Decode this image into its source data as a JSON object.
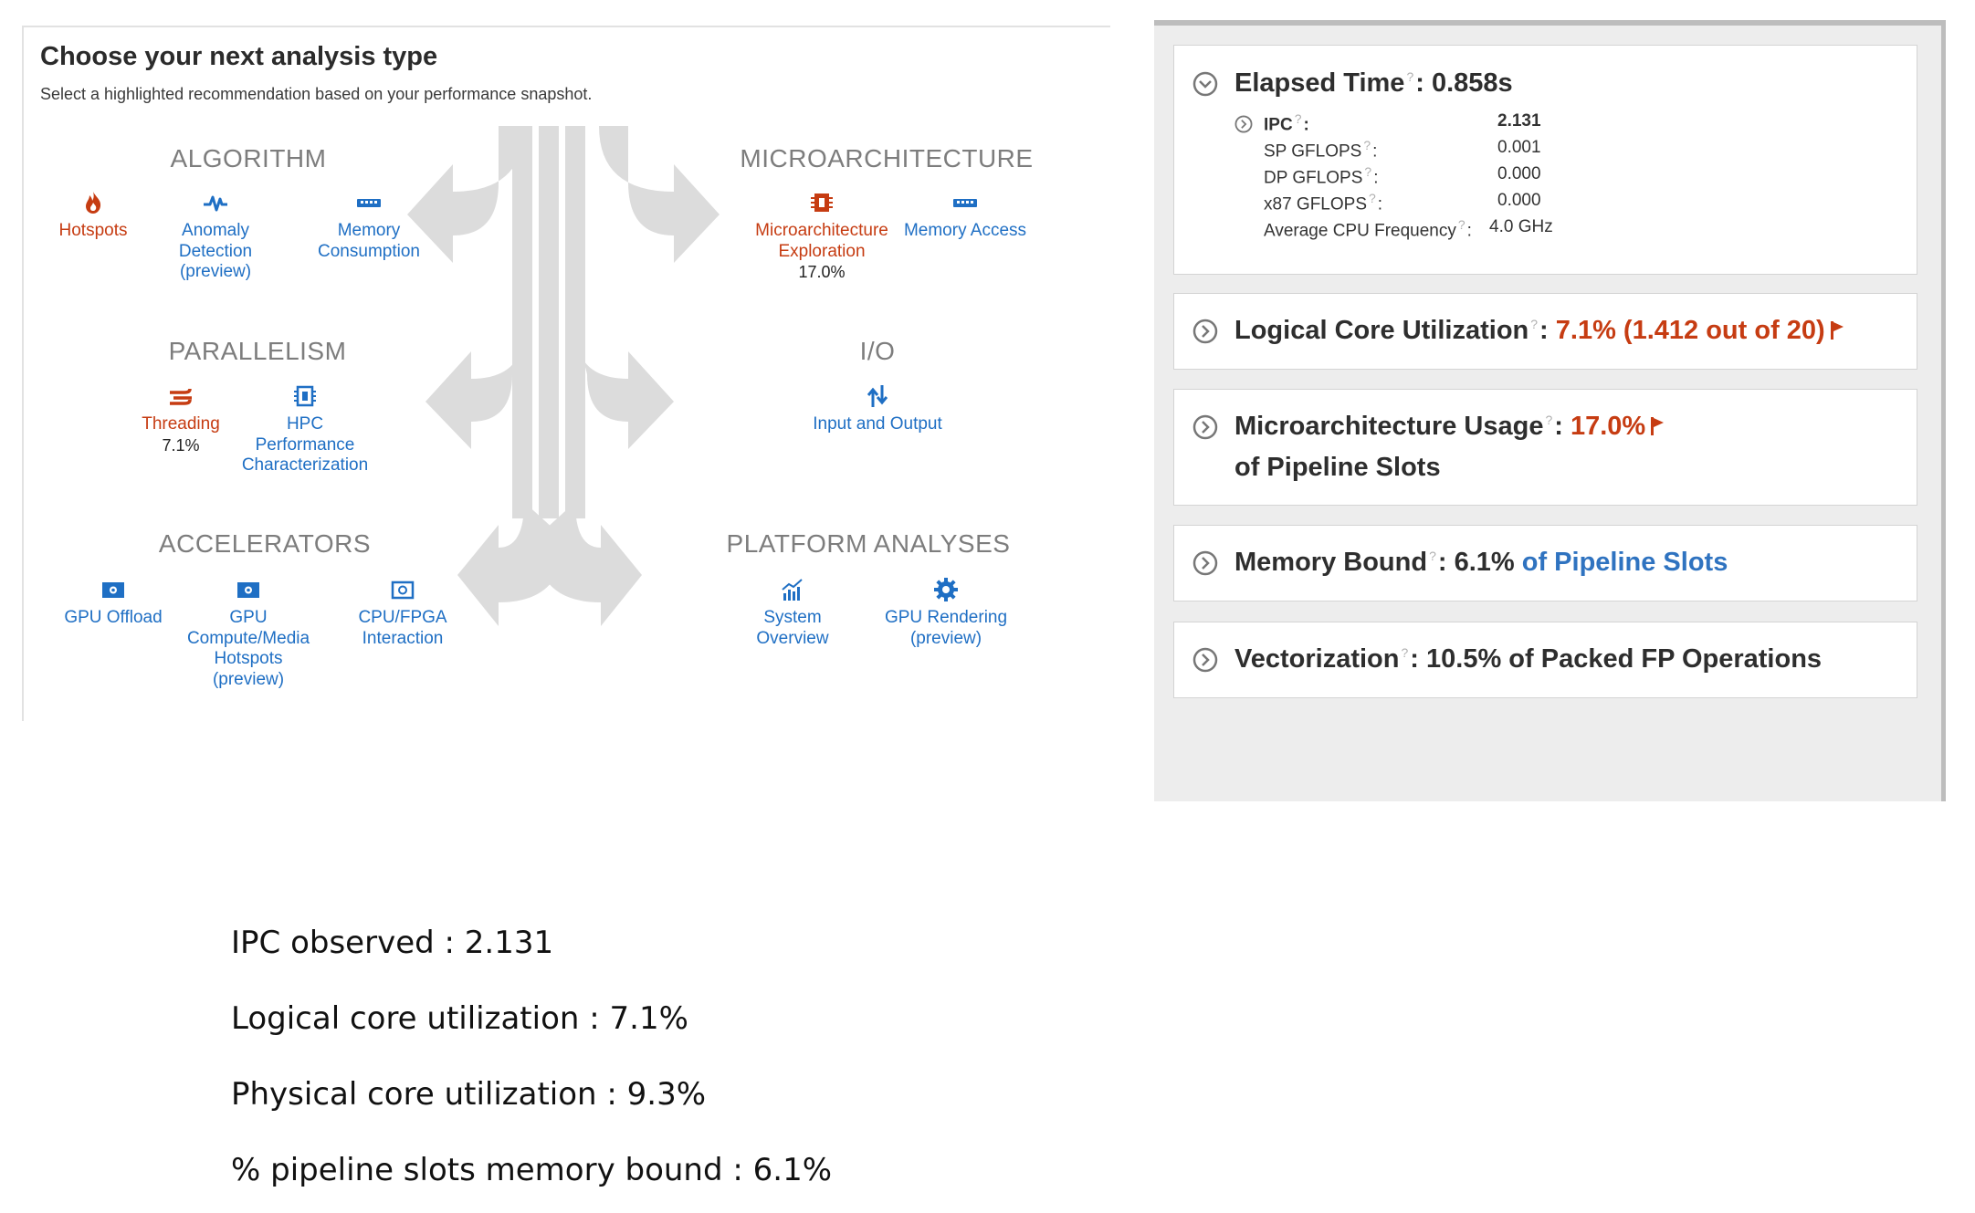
{
  "analysis": {
    "title": "Choose your next analysis type",
    "subtitle": "Select a highlighted recommendation based on your performance snapshot.",
    "categories": {
      "algorithm": "ALGORITHM",
      "parallelism": "PARALLELISM",
      "accelerators": "ACCELERATORS",
      "microarchitecture": "MICROARCHITECTURE",
      "io": "I/O",
      "platform": "PLATFORM ANALYSES"
    },
    "items": {
      "hotspots": {
        "label": "Hotspots",
        "icon": "flame-icon"
      },
      "anomaly": {
        "label": "Anomaly\nDetection\n(preview)",
        "icon": "pulse-icon"
      },
      "memory_consumption": {
        "label": "Memory\nConsumption",
        "icon": "memory-chip-icon"
      },
      "threading": {
        "label": "Threading",
        "value": "7.1%",
        "icon": "threads-icon"
      },
      "hpc": {
        "label": "HPC\nPerformance\nCharacterization",
        "icon": "cpu-icon"
      },
      "gpu_offload": {
        "label": "GPU Offload",
        "icon": "gpu-card-icon"
      },
      "gpu_compute": {
        "label": "GPU\nCompute/Media\nHotspots\n(preview)",
        "icon": "gpu-card-icon"
      },
      "cpu_fpga": {
        "label": "CPU/FPGA\nInteraction",
        "icon": "fpga-card-icon"
      },
      "microarch_exploration": {
        "label": "Microarchitecture\nExploration",
        "value": "17.0%",
        "icon": "cpu-icon"
      },
      "memory_access": {
        "label": "Memory Access",
        "icon": "memory-chip-icon"
      },
      "input_output": {
        "label": "Input and Output",
        "icon": "up-down-arrows-icon"
      },
      "system_overview": {
        "label": "System\nOverview",
        "icon": "bar-chart-icon"
      },
      "gpu_rendering": {
        "label": "GPU Rendering\n(preview)",
        "icon": "gear-icon"
      }
    }
  },
  "summary": {
    "elapsed": {
      "label": "Elapsed Time",
      "value": "0.858s"
    },
    "metrics": [
      {
        "label": "IPC",
        "value": "2.131"
      },
      {
        "label": "SP GFLOPS",
        "value": "0.001"
      },
      {
        "label": "DP GFLOPS",
        "value": "0.000"
      },
      {
        "label": "x87 GFLOPS",
        "value": "0.000"
      },
      {
        "label": "Average CPU Frequency",
        "value": "4.0 GHz"
      }
    ],
    "logical_core": {
      "label": "Logical Core Utilization",
      "value": "7.1% (1.412 out of 20)"
    },
    "microarch": {
      "label": "Microarchitecture Usage",
      "value": "17.0%",
      "suffix": "of Pipeline Slots"
    },
    "memory_bound": {
      "label": "Memory Bound",
      "value": "6.1%",
      "suffix": "of Pipeline Slots"
    },
    "vectorization": {
      "label": "Vectorization",
      "value": "10.5% of Packed FP Operations"
    }
  },
  "notes": [
    "IPC observed : 2.131",
    "Logical core utilization : 7.1%",
    "Physical core utilization : 9.3%",
    "% pipeline slots memory bound : 6.1%"
  ],
  "colors": {
    "recommended": "#c63c12",
    "link": "#1f6fc4",
    "category": "#7d7d7d",
    "arrow": "#dcdcdc"
  }
}
